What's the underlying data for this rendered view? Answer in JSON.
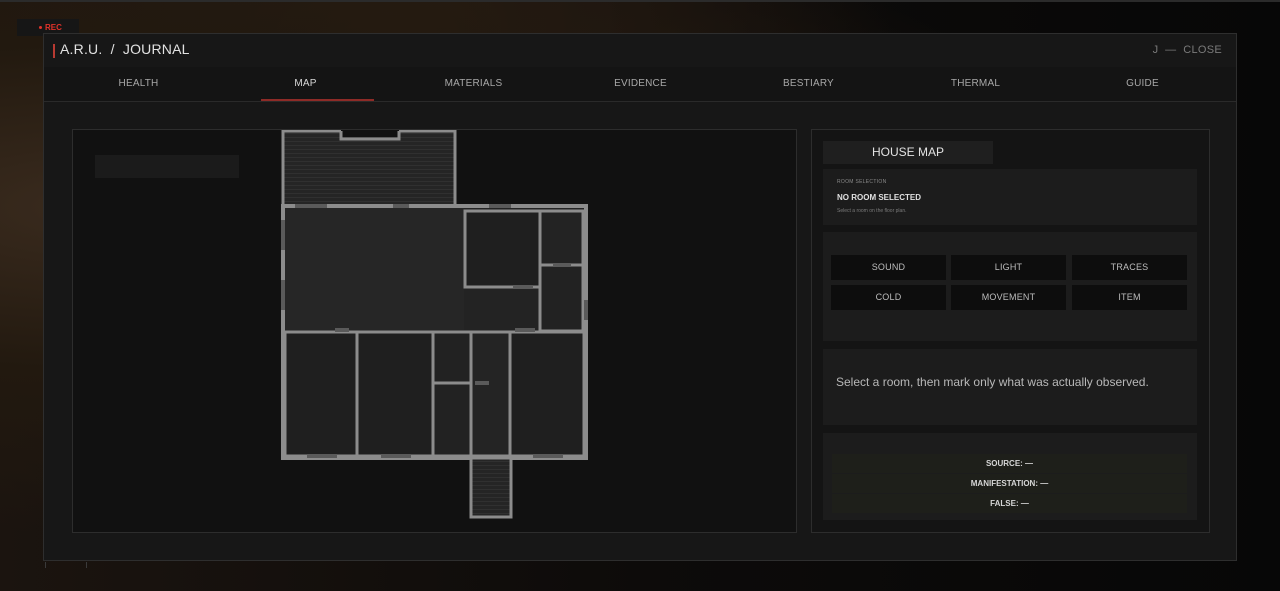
{
  "recording": {
    "label": "REC",
    "color": "#e0332a"
  },
  "header": {
    "title": "A.R.U.  /  JOURNAL",
    "close_label": "J  —  CLOSE"
  },
  "tabs": [
    {
      "label": "HEALTH",
      "active": false
    },
    {
      "label": "MAP",
      "active": true
    },
    {
      "label": "MATERIALS",
      "active": false
    },
    {
      "label": "EVIDENCE",
      "active": false
    },
    {
      "label": "BESTIARY",
      "active": false
    },
    {
      "label": "THERMAL",
      "active": false
    },
    {
      "label": "GUIDE",
      "active": false
    }
  ],
  "sidebar": {
    "title": "HOUSE MAP",
    "room_selection": {
      "caption": "ROOM SELECTION",
      "value": "NO ROOM SELECTED",
      "hint": "Select a room on the floor plan."
    },
    "observations": [
      "SOUND",
      "LIGHT",
      "TRACES",
      "COLD",
      "MOVEMENT",
      "ITEM"
    ],
    "instruction": "Select a room, then mark only what was actually observed.",
    "summary": {
      "source": "SOURCE: —",
      "manifestation": "MANIFESTATION: —",
      "false": "FALSE: —"
    }
  },
  "colors": {
    "accent": "#b83a32",
    "tab_underline": "#8e2b27",
    "wall": "#8c8c8c"
  }
}
